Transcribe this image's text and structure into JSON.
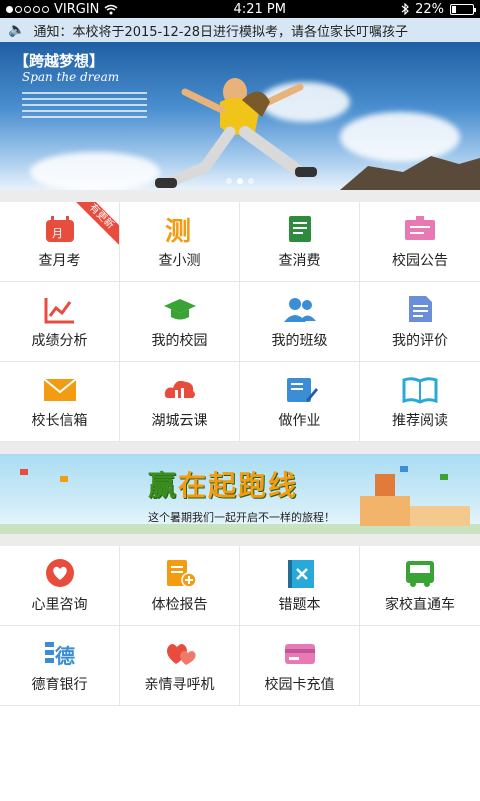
{
  "statusbar": {
    "carrier": "VIRGIN",
    "time": "4:21 PM",
    "battery": "22%",
    "battery_fraction": 0.22
  },
  "notice": {
    "text": "通知：本校将于2015-12-28日进行模拟考，请各位家长叮嘱孩子"
  },
  "banner": {
    "title": "【跨越梦想】",
    "subtitle": "Span the dream",
    "active_dot": 1,
    "dot_count": 3
  },
  "grid1": [
    {
      "name": "query-monthly-exam",
      "label": "查月考",
      "icon": "calendar-icon",
      "color": "#e74c3c",
      "badge": "有更新"
    },
    {
      "name": "query-quiz",
      "label": "查小测",
      "icon": "quiz-icon",
      "color": "#f39c12"
    },
    {
      "name": "query-spending",
      "label": "查消费",
      "icon": "receipt-icon",
      "color": "#2e8b3e"
    },
    {
      "name": "campus-notice",
      "label": "校园公告",
      "icon": "notice-icon",
      "color": "#e879b5"
    },
    {
      "name": "grade-analysis",
      "label": "成绩分析",
      "icon": "chart-icon",
      "color": "#e74c3c"
    },
    {
      "name": "my-school",
      "label": "我的校园",
      "icon": "graduation-cap-icon",
      "color": "#3aa335"
    },
    {
      "name": "my-class",
      "label": "我的班级",
      "icon": "people-icon",
      "color": "#3b8ed6"
    },
    {
      "name": "my-evaluation",
      "label": "我的评价",
      "icon": "document-icon",
      "color": "#6b8ed8"
    },
    {
      "name": "principal-mailbox",
      "label": "校长信箱",
      "icon": "mail-icon",
      "color": "#f39c12"
    },
    {
      "name": "huzhou-cloud-class",
      "label": "湖城云课",
      "icon": "cloud-class-icon",
      "color": "#e74c3c"
    },
    {
      "name": "homework",
      "label": "做作业",
      "icon": "homework-icon",
      "color": "#3b8ed6"
    },
    {
      "name": "recommended-reading",
      "label": "推荐阅读",
      "icon": "book-icon",
      "color": "#29a9d8"
    }
  ],
  "ad": {
    "slogan": [
      "赢",
      "在起跑线"
    ],
    "subtext": "这个暑期我们一起开启不一样的旅程！"
  },
  "grid2": [
    {
      "name": "counseling",
      "label": "心里咨询",
      "icon": "heart-chat-icon",
      "color": "#e74c3c"
    },
    {
      "name": "health-report",
      "label": "体检报告",
      "icon": "report-plus-icon",
      "color": "#f39c12"
    },
    {
      "name": "wrong-questions",
      "label": "错题本",
      "icon": "notebook-icon",
      "color": "#29a9d8"
    },
    {
      "name": "school-bus",
      "label": "家校直通车",
      "icon": "bus-icon",
      "color": "#3aa335"
    },
    {
      "name": "moral-bank",
      "label": "德育银行",
      "icon": "moral-bank-icon",
      "color": "#3b8ed6"
    },
    {
      "name": "family-pager",
      "label": "亲情寻呼机",
      "icon": "hearts-icon",
      "color": "#e74c3c"
    },
    {
      "name": "card-recharge",
      "label": "校园卡充值",
      "icon": "card-icon",
      "color": "#e879b5"
    }
  ]
}
